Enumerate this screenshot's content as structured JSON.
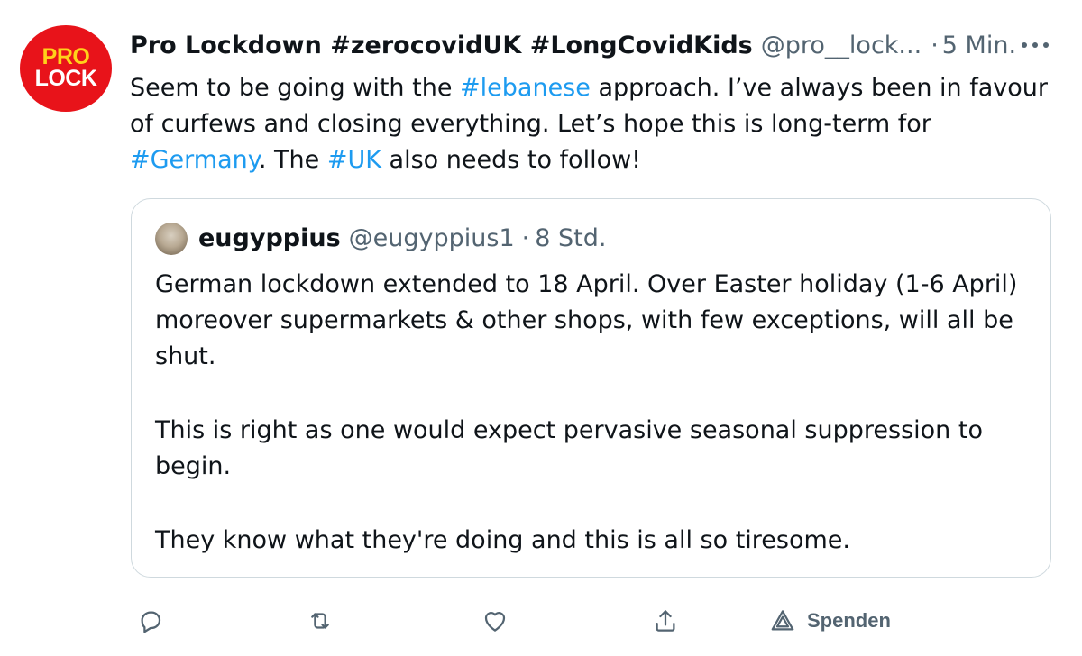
{
  "tweet": {
    "avatar_text_line1": "PRO",
    "avatar_text_line2": "LOCK",
    "display_name": "Pro Lockdown #zerocovidUK #LongCovidKids",
    "handle": "@pro__lock...",
    "separator": "·",
    "time": "5 Min.",
    "text_parts": [
      {
        "text": "Seem to be going with the ",
        "type": "plain"
      },
      {
        "text": "#lebanese",
        "type": "hashtag"
      },
      {
        "text": " approach. I’ve always been in favour of curfews and closing everything. Let’s hope this is long-term for ",
        "type": "plain"
      },
      {
        "text": "#Germany",
        "type": "hashtag"
      },
      {
        "text": ". The ",
        "type": "plain"
      },
      {
        "text": "#UK",
        "type": "hashtag"
      },
      {
        "text": " also needs to follow!",
        "type": "plain"
      }
    ],
    "more_icon": "more-horizontal-icon"
  },
  "quote": {
    "display_name": "eugyppius",
    "handle": "@eugyppius1",
    "separator": "·",
    "time": "8 Std.",
    "paragraphs": [
      "German lockdown extended to 18 April. Over Easter holiday (1-6 April) moreover supermarkets & other shops, with few exceptions, will all be shut.",
      "This is right as one would expect pervasive seasonal suppression to begin.",
      "They know what they're doing and this is all so tiresome."
    ]
  },
  "actions": {
    "reply_icon": "reply-icon",
    "retweet_icon": "retweet-icon",
    "like_icon": "like-heart-icon",
    "share_icon": "share-icon",
    "spenden_icon": "tip-jar-icon",
    "spenden_label": "Spenden"
  },
  "colors": {
    "link": "#1d9bf0",
    "secondary_text": "#536471",
    "border": "#cfd9de",
    "avatar_bg": "#e8131a",
    "avatar_pro": "#ffd21a"
  }
}
